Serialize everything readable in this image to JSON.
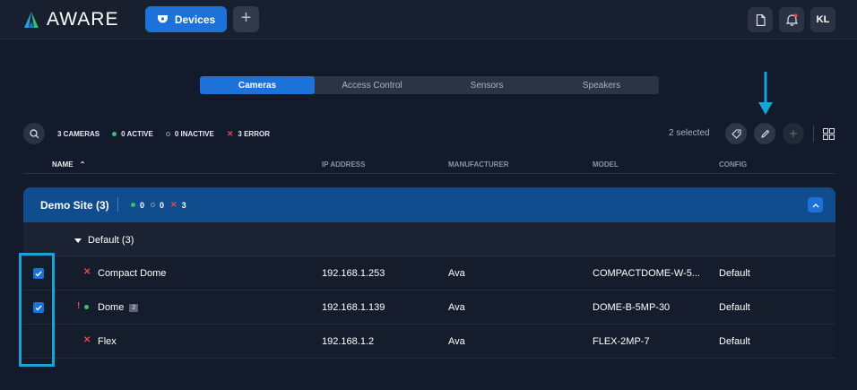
{
  "app": {
    "name": "AWARE"
  },
  "header": {
    "devices_label": "Devices",
    "add_label": "+",
    "user_initials": "KL"
  },
  "tabs": [
    {
      "label": "Cameras",
      "active": true
    },
    {
      "label": "Access Control",
      "active": false
    },
    {
      "label": "Sensors",
      "active": false
    },
    {
      "label": "Speakers",
      "active": false
    }
  ],
  "filters": {
    "cameras": "3 CAMERAS",
    "active": "0 ACTIVE",
    "inactive": "0 INACTIVE",
    "error": "3 ERROR"
  },
  "toolbar": {
    "selected_text": "2 selected"
  },
  "columns": {
    "name": "NAME",
    "ip": "IP ADDRESS",
    "manufacturer": "MANUFACTURER",
    "model": "MODEL",
    "config": "CONFIG"
  },
  "site": {
    "name": "Demo Site (3)",
    "active_count": "0",
    "inactive_count": "0",
    "error_count": "3"
  },
  "group": {
    "label": "Default (3)"
  },
  "rows": [
    {
      "status": "error",
      "status_glyph": "✕",
      "name": "Compact Dome",
      "ip": "192.168.1.253",
      "manufacturer": "Ava",
      "model": "COMPACTDOME-W-5...",
      "config": "Default",
      "checked": true,
      "badge": ""
    },
    {
      "status": "warning",
      "status_glyph": "!",
      "name": "Dome",
      "ip": "192.168.1.139",
      "manufacturer": "Ava",
      "model": "DOME-B-5MP-30",
      "config": "Default",
      "checked": true,
      "badge": "2"
    },
    {
      "status": "error",
      "status_glyph": "✕",
      "name": "Flex",
      "ip": "192.168.1.2",
      "manufacturer": "Ava",
      "model": "FLEX-2MP-7",
      "config": "Default",
      "checked": false,
      "badge": ""
    }
  ],
  "colors": {
    "accent": "#1c72d8",
    "site_bar": "#0f4d8f",
    "error": "#e5484d",
    "active": "#35c26a",
    "annotation": "#1aa1d6"
  }
}
